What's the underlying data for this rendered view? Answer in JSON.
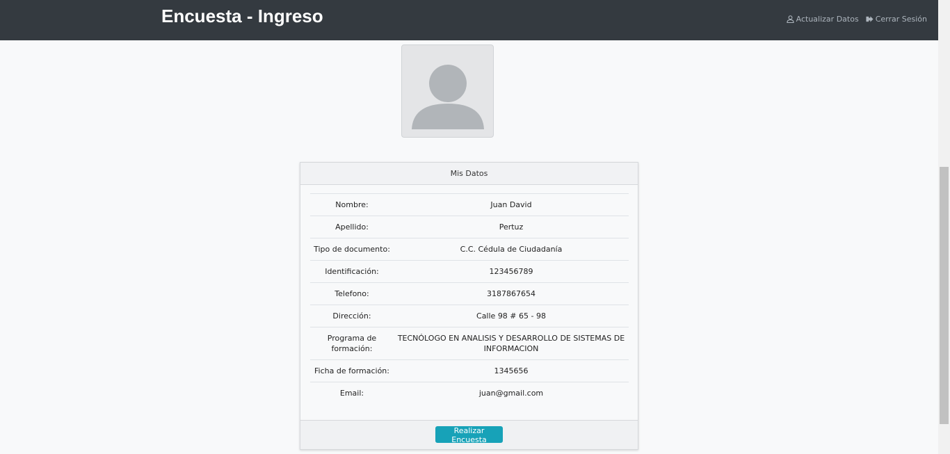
{
  "header": {
    "title": "Encuesta - Ingreso",
    "links": [
      {
        "label": "Actualizar Datos",
        "icon": "user-icon"
      },
      {
        "label": "Cerrar Sesión",
        "icon": "sign-out-icon"
      }
    ]
  },
  "avatar": {
    "icon": "user-placeholder-icon"
  },
  "card": {
    "title": "Mis Datos",
    "rows": [
      {
        "label": "Nombre:",
        "value": "Juan David"
      },
      {
        "label": "Apellido:",
        "value": "Pertuz"
      },
      {
        "label": "Tipo de documento:",
        "value": "C.C. Cédula de Ciudadanía"
      },
      {
        "label": "Identificación:",
        "value": "123456789"
      },
      {
        "label": "Telefono:",
        "value": "3187867654"
      },
      {
        "label": "Dirección:",
        "value": "Calle 98 # 65 - 98"
      },
      {
        "label": "Programa de formación:",
        "value": "TECNÓLOGO EN ANALISIS Y DESARROLLO DE SISTEMAS DE INFORMACION"
      },
      {
        "label": "Ficha de formación:",
        "value": "1345656"
      },
      {
        "label": "Email:",
        "value": "juan@gmail.com"
      }
    ],
    "button": "Realizar Encuesta"
  },
  "colors": {
    "navbar": "#343a40",
    "button": "#17a2b8"
  }
}
